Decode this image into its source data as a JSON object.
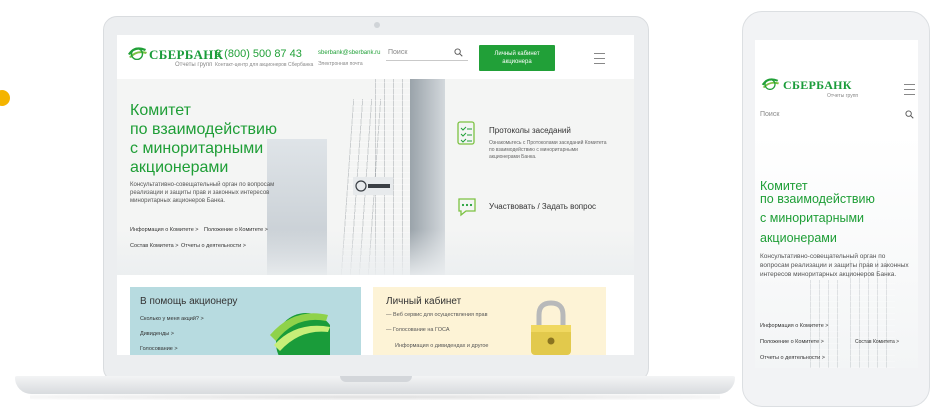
{
  "brand": {
    "name": "СБЕРБАНК",
    "tagline": "Отчеты групп",
    "color_primary": "#21a038"
  },
  "header": {
    "phone": "8 (800) 500 87 43",
    "phone_note": "Контакт-центр для акционеров Сбербанка",
    "email": "sberbank@sberbank.ru",
    "email_note": "Электронная почта",
    "search_placeholder": "Поиск",
    "cabinet_button": "Личный кабинет акционера"
  },
  "hero": {
    "title_lines": [
      "Комитет",
      "по взаимодействию",
      "с миноритарными",
      "акционерами"
    ],
    "description": "Консультативно-совещательный орган по вопросам реализации и защиты прав и законных интересов миноритарных акционеров Банка.",
    "links": [
      "Информация о Комитете >",
      "Положение о Комитете >",
      "Состав Комитета >",
      "Отчеты о деятельности >"
    ]
  },
  "features": [
    {
      "icon": "document-list-icon",
      "title": "Протоколы заседаний",
      "description": "Ознакомьтесь с Протоколами заседаний Комитета по взаимодействию с миноритарными акционерами Банка."
    },
    {
      "icon": "chat-bubble-icon",
      "title": "Участвовать / Задать вопрос",
      "description": ""
    }
  ],
  "cards": {
    "help": {
      "title": "В помощь акционеру",
      "links": [
        "Сколько у меня акций? >",
        "Дивиденды >",
        "Голосование >"
      ]
    },
    "cabinet": {
      "title": "Личный кабинет",
      "items": [
        "Веб сервис для осуществления прав",
        "Голосование на ГОСА",
        "Информация о дивидендах и другое"
      ]
    }
  },
  "mobile": {
    "search_placeholder": "Поиск",
    "title_lines": [
      "Комитет",
      "по взаимодействию",
      "с миноритарными",
      "акционерами"
    ],
    "description": "Консультативно-совещательный орган по вопросам реализации и защиты прав и законных интересов миноритарных акционеров Банка.",
    "links": [
      "Информация о Комитете >",
      "Положение о Комитете >",
      "Состав Комитета >",
      "Отчеты о деятельности >"
    ]
  }
}
